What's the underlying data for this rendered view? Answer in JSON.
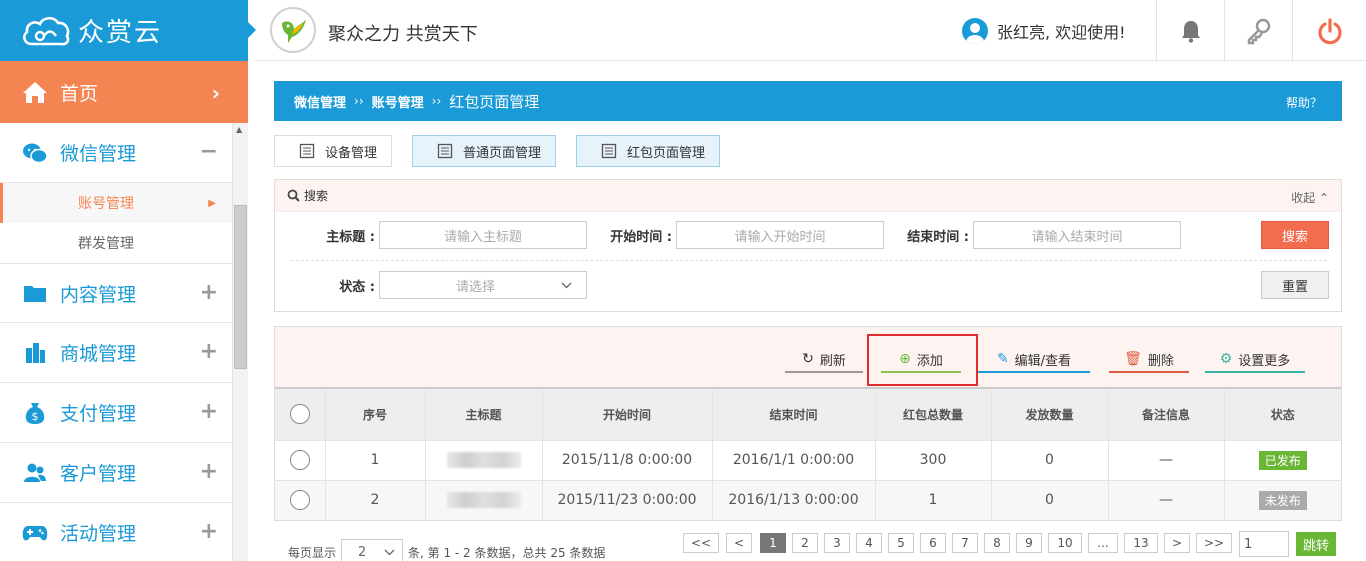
{
  "app": {
    "name": "众赏云",
    "slogan": "聚众之力 共赏天下"
  },
  "user": {
    "greeting": "张红亮, 欢迎使用!"
  },
  "header_icons": [
    "bell-icon",
    "key-icon",
    "power-icon"
  ],
  "colors": {
    "brand": "#1a9ad6",
    "accent": "#f58453",
    "search_button": "#f26c4f",
    "published": "#6ab635",
    "unpublished": "#aaaaaa",
    "highlight": "#e02d2d"
  },
  "sidebar": {
    "home": {
      "label": "首页",
      "chevron": "›"
    },
    "items": [
      {
        "label": "微信管理",
        "toggle": "−",
        "icon": "wechat-icon"
      },
      {
        "label": "内容管理",
        "toggle": "+",
        "icon": "folder-icon"
      },
      {
        "label": "商城管理",
        "toggle": "+",
        "icon": "building-icon"
      },
      {
        "label": "支付管理",
        "toggle": "+",
        "icon": "money-bag-icon"
      },
      {
        "label": "客户管理",
        "toggle": "+",
        "icon": "users-icon"
      },
      {
        "label": "活动管理",
        "toggle": "+",
        "icon": "gamepad-icon"
      }
    ],
    "subitems": [
      {
        "label": "账号管理",
        "active": true
      },
      {
        "label": "群发管理",
        "active": false
      }
    ]
  },
  "breadcrumb": {
    "level1": "微信管理",
    "level2": "账号管理",
    "level3": "红包页面管理",
    "sep": "››",
    "help": "帮助？"
  },
  "tabs": [
    {
      "label": "设备管理"
    },
    {
      "label": "普通页面管理"
    },
    {
      "label": "红包页面管理"
    }
  ],
  "search": {
    "title": "搜索",
    "collapse": "收起 ⌃",
    "fields": {
      "title_label": "主标题 :",
      "title_placeholder": "请输入主标题",
      "start_label": "开始时间 :",
      "start_placeholder": "请输入开始时间",
      "end_label": "结束时间 :",
      "end_placeholder": "请输入结束时间",
      "status_label": "状态 :",
      "status_placeholder": "请选择"
    },
    "search_button": "搜索",
    "reset_button": "重置"
  },
  "toolbar": {
    "refresh": "刷新",
    "add": "添加",
    "edit": "编辑/查看",
    "delete": "删除",
    "more": "设置更多"
  },
  "table": {
    "headers": [
      "序号",
      "主标题",
      "开始时间",
      "结束时间",
      "红包总数量",
      "发放数量",
      "备注信息",
      "状态"
    ],
    "rows": [
      {
        "no": "1",
        "start": "2015/11/8 0:00:00",
        "end": "2016/1/1 0:00:00",
        "total": "300",
        "issued": "0",
        "note": "—",
        "status": "已发布"
      },
      {
        "no": "2",
        "start": "2015/11/23 0:00:00",
        "end": "2016/1/13 0:00:00",
        "total": "1",
        "issued": "0",
        "note": "—",
        "status": "未发布"
      }
    ]
  },
  "pager": {
    "per_page_label": "每页显示",
    "per_page": "2",
    "summary": "条, 第 1 - 2 条数据，总共 25 条数据",
    "pages": [
      "<<",
      "<",
      "1",
      "2",
      "3",
      "4",
      "5",
      "6",
      "7",
      "8",
      "9",
      "10",
      "...",
      "13",
      ">",
      ">>"
    ],
    "current": "1",
    "jump_value": "1",
    "jump_label": "跳转"
  }
}
